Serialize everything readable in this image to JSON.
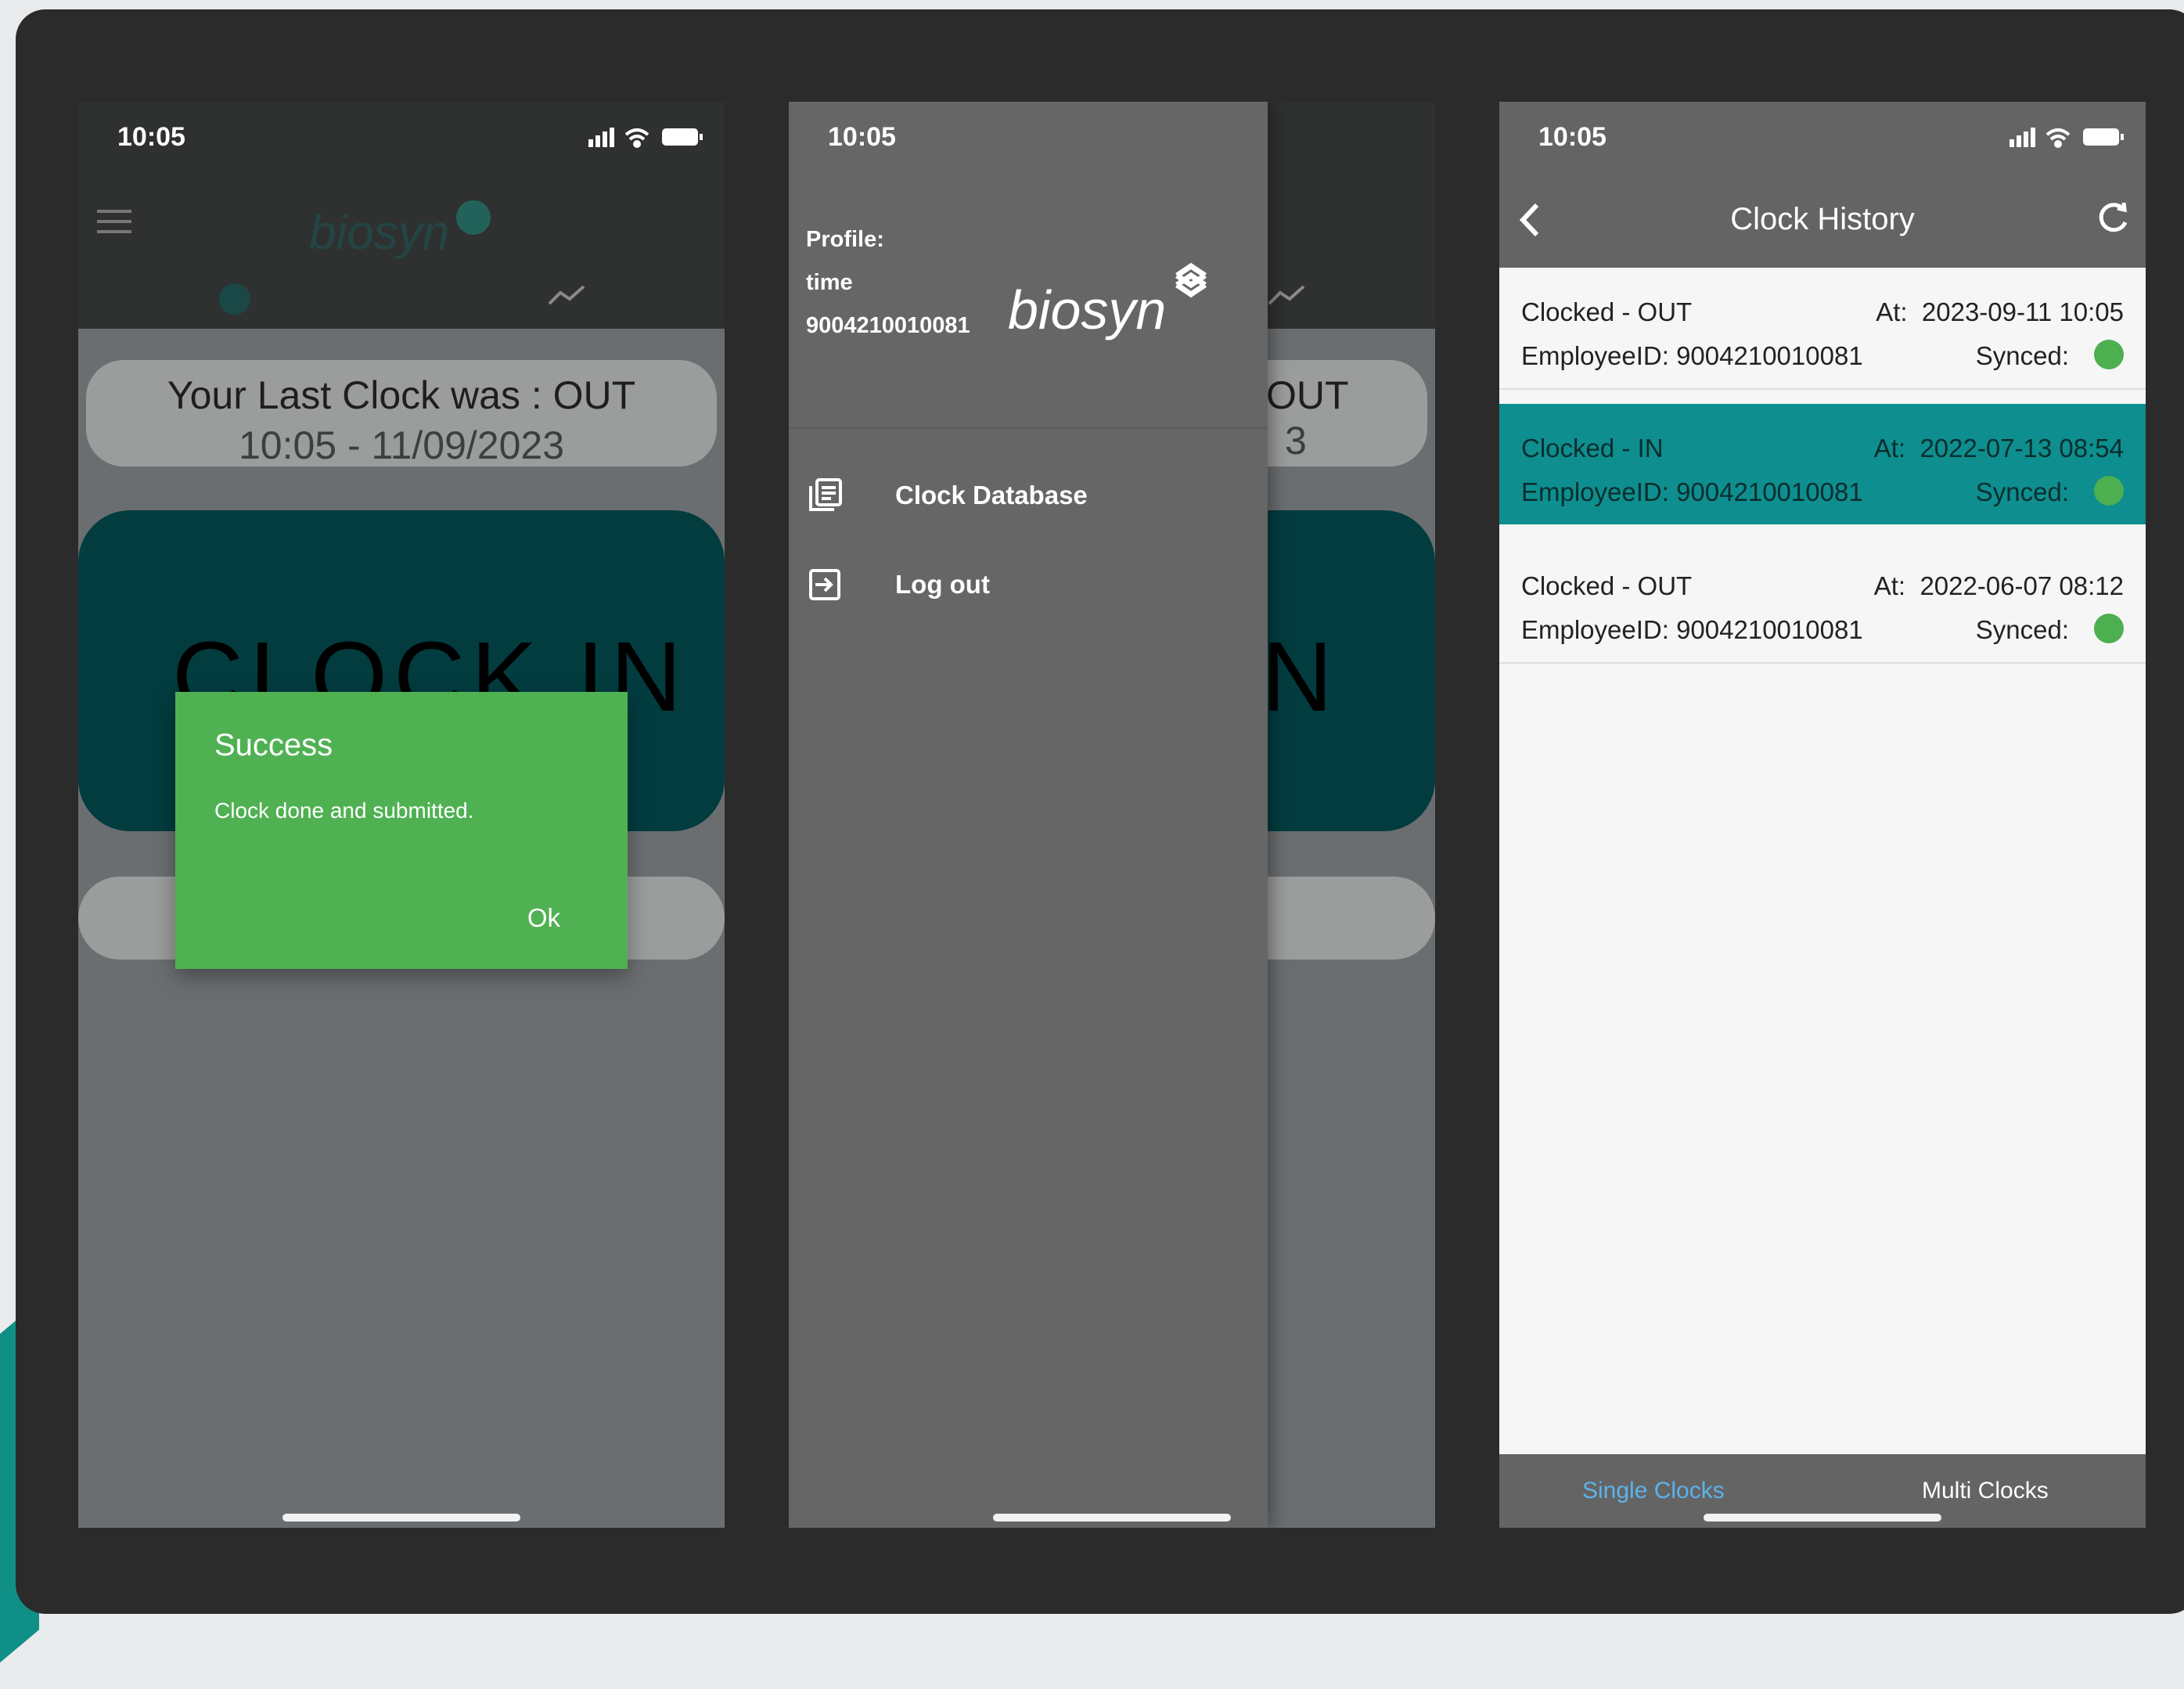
{
  "status_bar": {
    "time": "10:05"
  },
  "phone1": {
    "last_clock_line1": "Your Last Clock was : OUT",
    "last_clock_line2": "10:05 - 11/09/2023",
    "clock_in_label": "CLOCK IN",
    "dialog": {
      "title": "Success",
      "message": "Clock done and submitted.",
      "ok_label": "Ok"
    }
  },
  "phone2": {
    "background_card_line1": "OUT",
    "background_card_line2": "3",
    "background_button_label": "N",
    "drawer": {
      "profile_label": "Profile:",
      "profile_name": "time",
      "profile_id": "9004210010081",
      "logo_text": "biosyn",
      "items": [
        {
          "label": "Clock Database",
          "icon": "database-icon"
        },
        {
          "label": "Log out",
          "icon": "logout-icon"
        }
      ]
    }
  },
  "phone3": {
    "title": "Clock History",
    "at_label": "At:",
    "synced_label": "Synced:",
    "rows": [
      {
        "clocked": "Clocked - OUT",
        "at": "2023-09-11 10:05",
        "employee": "EmployeeID: 9004210010081",
        "selected": false
      },
      {
        "clocked": "Clocked - IN",
        "at": "2022-07-13 08:54",
        "employee": "EmployeeID: 9004210010081",
        "selected": true
      },
      {
        "clocked": "Clocked - OUT",
        "at": "2022-06-07 08:12",
        "employee": "EmployeeID: 9004210010081",
        "selected": false
      }
    ],
    "tabs": {
      "single": "Single Clocks",
      "multi": "Multi Clocks"
    }
  },
  "colors": {
    "dialog_green": "#50b152",
    "selected_row_teal": "#0e8e8e",
    "synced_green": "#4caf50",
    "active_tab_blue": "#5cb2ea",
    "clock_button_teal": "#023c3f"
  }
}
